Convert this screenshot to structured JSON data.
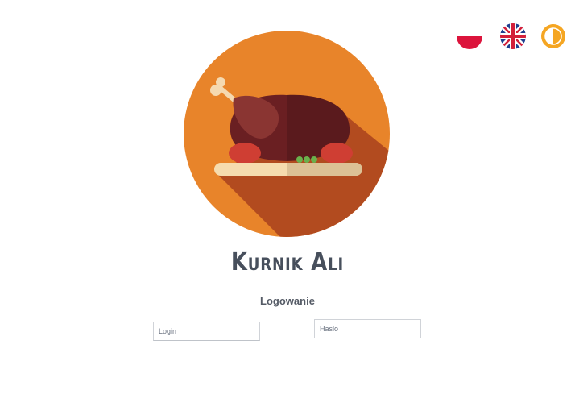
{
  "app": {
    "title": "Kurnik Ali",
    "subtitle": "Logowanie"
  },
  "controls": {
    "language_pl_icon": "poland-flag-icon",
    "language_en_icon": "uk-flag-icon",
    "contrast_icon": "contrast-icon"
  },
  "form": {
    "login_placeholder": "Login",
    "password_placeholder": "Haslo"
  },
  "colors": {
    "logo_circle": "#e8842a",
    "logo_shadow": "#b24b1f",
    "title": "#474f5c",
    "poland_red": "#dc143c",
    "contrast_orange": "#f5a623"
  }
}
